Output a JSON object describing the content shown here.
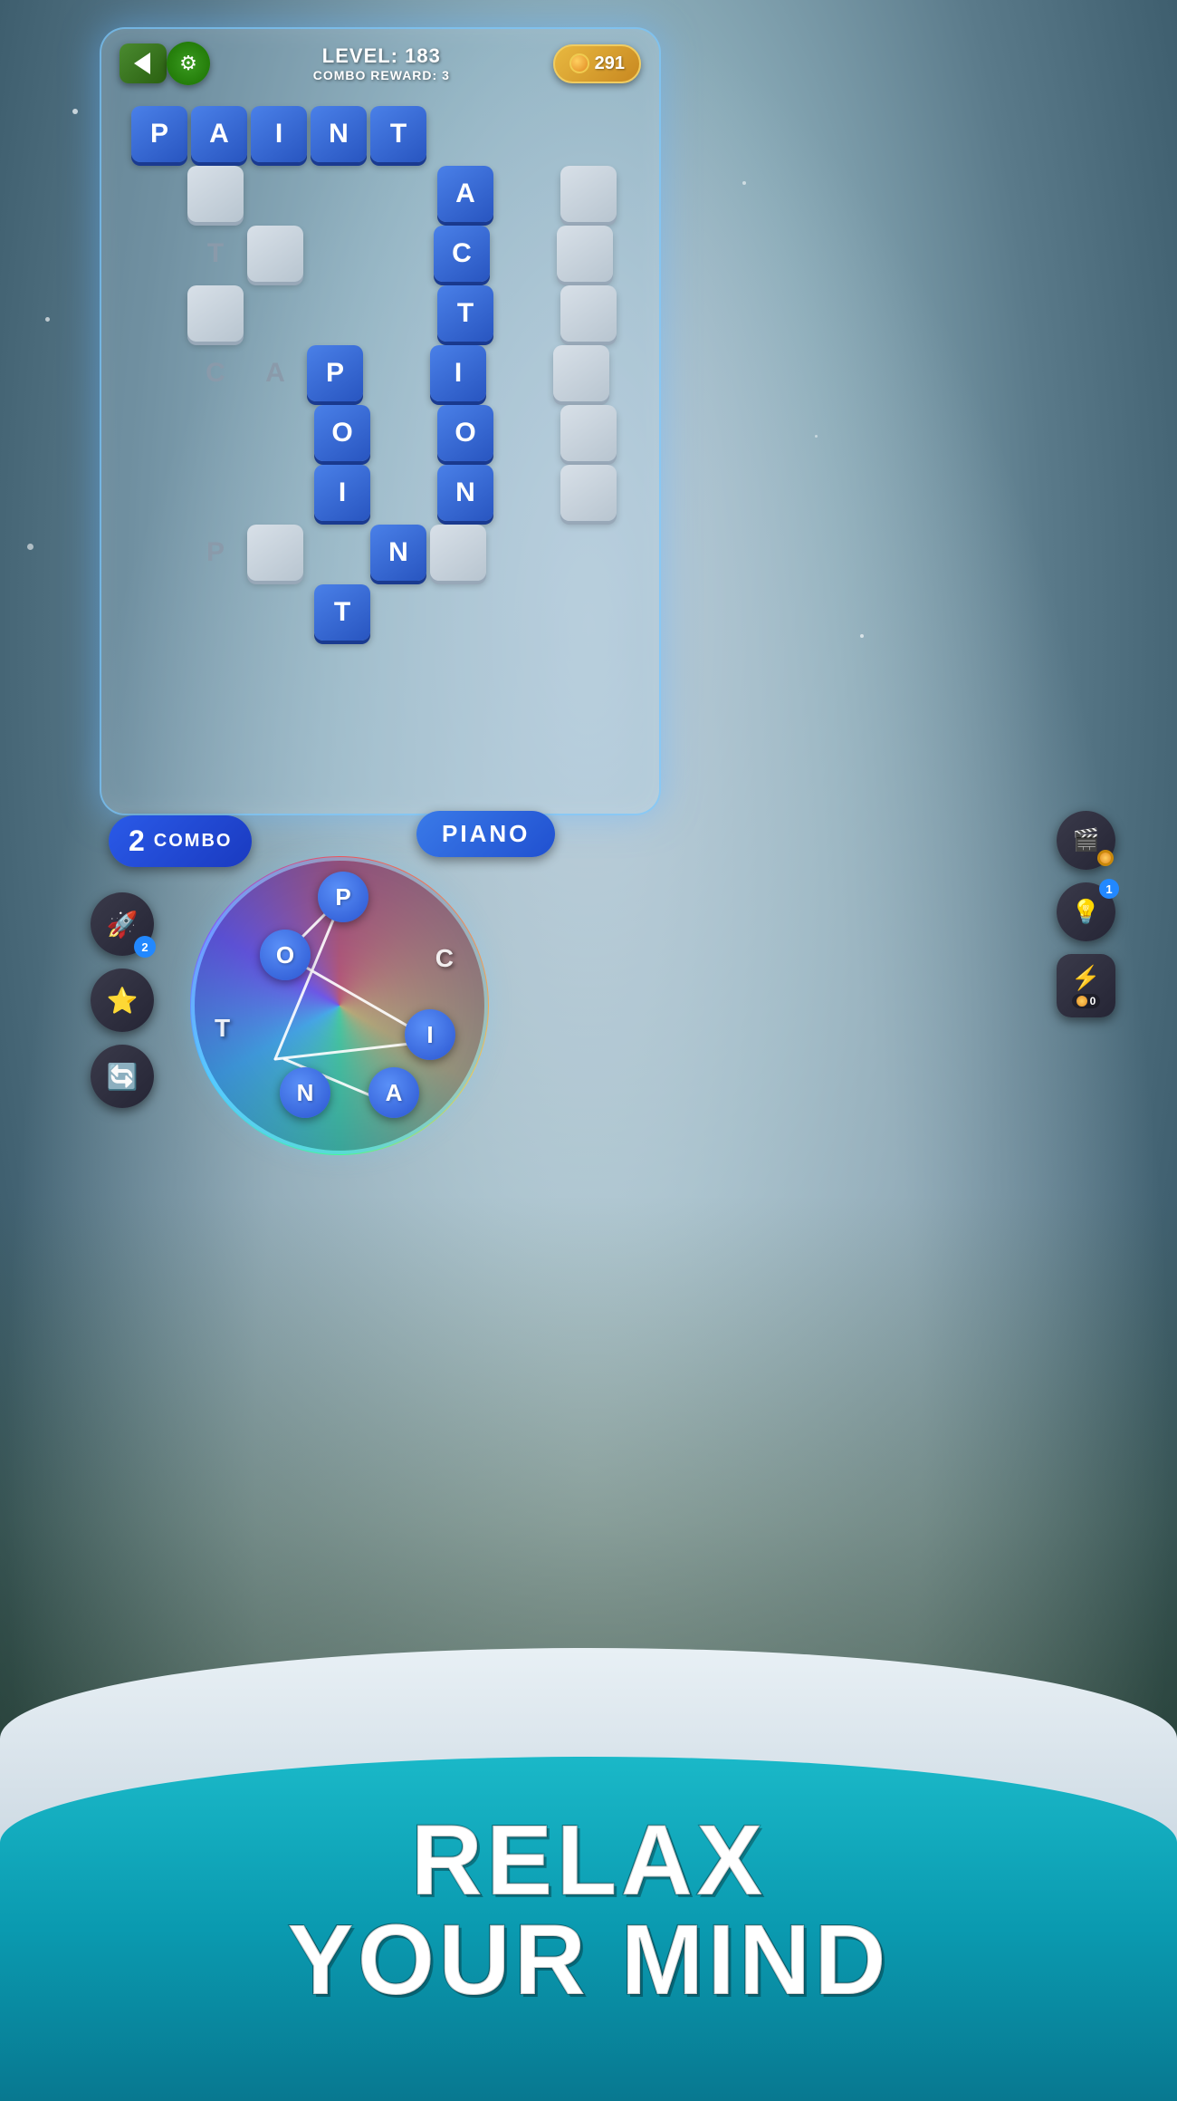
{
  "background": {
    "desc": "winter snowy forest background"
  },
  "header": {
    "level_label": "LEVEL: 183",
    "combo_reward_label": "COMBO REWARD: 3",
    "coins": "291",
    "back_label": "back",
    "settings_label": "settings"
  },
  "grid": {
    "description": "Crossword puzzle grid with words PAINT, ACTION, POINT, CAP letters",
    "words_placed": [
      "PAINT",
      "ACTION",
      "POINT"
    ]
  },
  "combo_badge": {
    "number": "2",
    "label": "COMBO"
  },
  "word_display": {
    "current_word": "PIANO"
  },
  "wheel": {
    "letters": [
      "P",
      "O",
      "C",
      "T",
      "I",
      "A",
      "N"
    ]
  },
  "left_buttons": {
    "rocket_badge": "2",
    "star_label": "star",
    "refresh_label": "refresh"
  },
  "right_buttons": {
    "video_label": "video",
    "lightbulb_badge": "1",
    "lightning_label": "lightning",
    "lightning_count": "0"
  },
  "relax_text": {
    "line1": "RELAX",
    "line2": "YOUR MIND"
  }
}
